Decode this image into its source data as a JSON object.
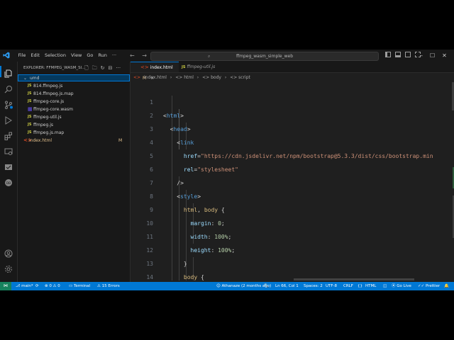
{
  "menu": [
    "File",
    "Edit",
    "Selection",
    "View",
    "Go",
    "Run",
    "···"
  ],
  "nav": {
    "back": "←",
    "forward": "→"
  },
  "command_center": "ffmpeg_wasm_simple_web",
  "sidebar": {
    "title": "EXPLORER: FFMPEG_WASM_SI...",
    "folder": "umd",
    "files": [
      {
        "icon": "JS",
        "type": "js",
        "name": "814.ffmpeg.js",
        "badge": ""
      },
      {
        "icon": "JS",
        "type": "js",
        "name": "814.ffmpeg.js.map",
        "badge": ""
      },
      {
        "icon": "JS",
        "type": "js",
        "name": "ffmpeg-core.js",
        "badge": ""
      },
      {
        "icon": "▦",
        "type": "wasm",
        "name": "ffmpeg-core.wasm",
        "badge": ""
      },
      {
        "icon": "JS",
        "type": "js",
        "name": "ffmpeg-util.js",
        "badge": ""
      },
      {
        "icon": "JS",
        "type": "js",
        "name": "ffmpeg.js",
        "badge": ""
      },
      {
        "icon": "JS",
        "type": "js",
        "name": "ffmpeg.js.map",
        "badge": ""
      },
      {
        "icon": "<>",
        "type": "html",
        "name": "index.html",
        "badge": "M"
      }
    ]
  },
  "tabs": [
    {
      "icon": "<>",
      "name": "index.html",
      "badge": "M",
      "close": "×",
      "active": true
    },
    {
      "icon": "JS",
      "name": "ffmpeg-util.js",
      "badge": "",
      "close": "",
      "active": false
    }
  ],
  "breadcrumb": [
    "index.html",
    "›",
    "<> html",
    "›",
    "<> body",
    "›",
    "<> script"
  ],
  "editor": {
    "line_numbers": [
      "1",
      "2",
      "3",
      "4",
      "5",
      "6",
      "7",
      "8",
      "9",
      "10",
      "11",
      "12",
      "13",
      "14",
      "15"
    ]
  },
  "statusbar": {
    "remote": "⋈",
    "branch": "main*",
    "sync": "⟳",
    "problems": "⊗ 0 ⚠ 0",
    "terminal": "Terminal",
    "errors": "15 Errors",
    "blame": "Athanaze (2 months ago)",
    "zoom": "🔍",
    "position": "Ln 66, Col 1",
    "spaces": "Spaces: 2",
    "encoding": "UTF-8",
    "eol": "CRLF",
    "braces": "{}",
    "language": "HTML",
    "golive": "Go Live",
    "prettier": "✓✓ Prettier",
    "bell": "🔔"
  },
  "colors": {
    "accent": "#0078d4",
    "background": "#1f1f1f",
    "statusbar": "#0078d4",
    "modified": "#e2c08d"
  }
}
